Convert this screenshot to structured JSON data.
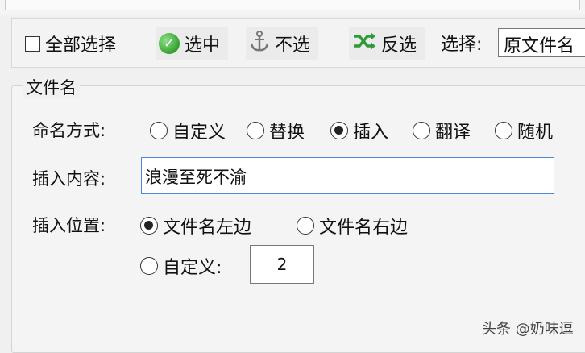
{
  "toolbar": {
    "select_all_label": "全部选择",
    "select_label": "选中",
    "unselect_label": "不选",
    "invert_label": "反选",
    "choose_label": "选择:",
    "choose_value": "原文件名"
  },
  "panel": {
    "title": "文件名",
    "naming_label": "命名方式:",
    "naming_options": [
      "自定义",
      "替换",
      "插入",
      "翻译",
      "随机"
    ],
    "naming_selected": "插入",
    "insert_content_label": "插入内容:",
    "insert_content_value": "浪漫至死不渝",
    "insert_position_label": "插入位置:",
    "position_left": "文件名左边",
    "position_right": "文件名右边",
    "position_custom": "自定义:",
    "position_selected": "文件名左边",
    "custom_value": "2"
  },
  "watermark": "头条 @奶味逗",
  "colors": {
    "check_green": "#33a12f",
    "invert_green": "#2e9b3a",
    "input_border": "#4a89d8"
  }
}
